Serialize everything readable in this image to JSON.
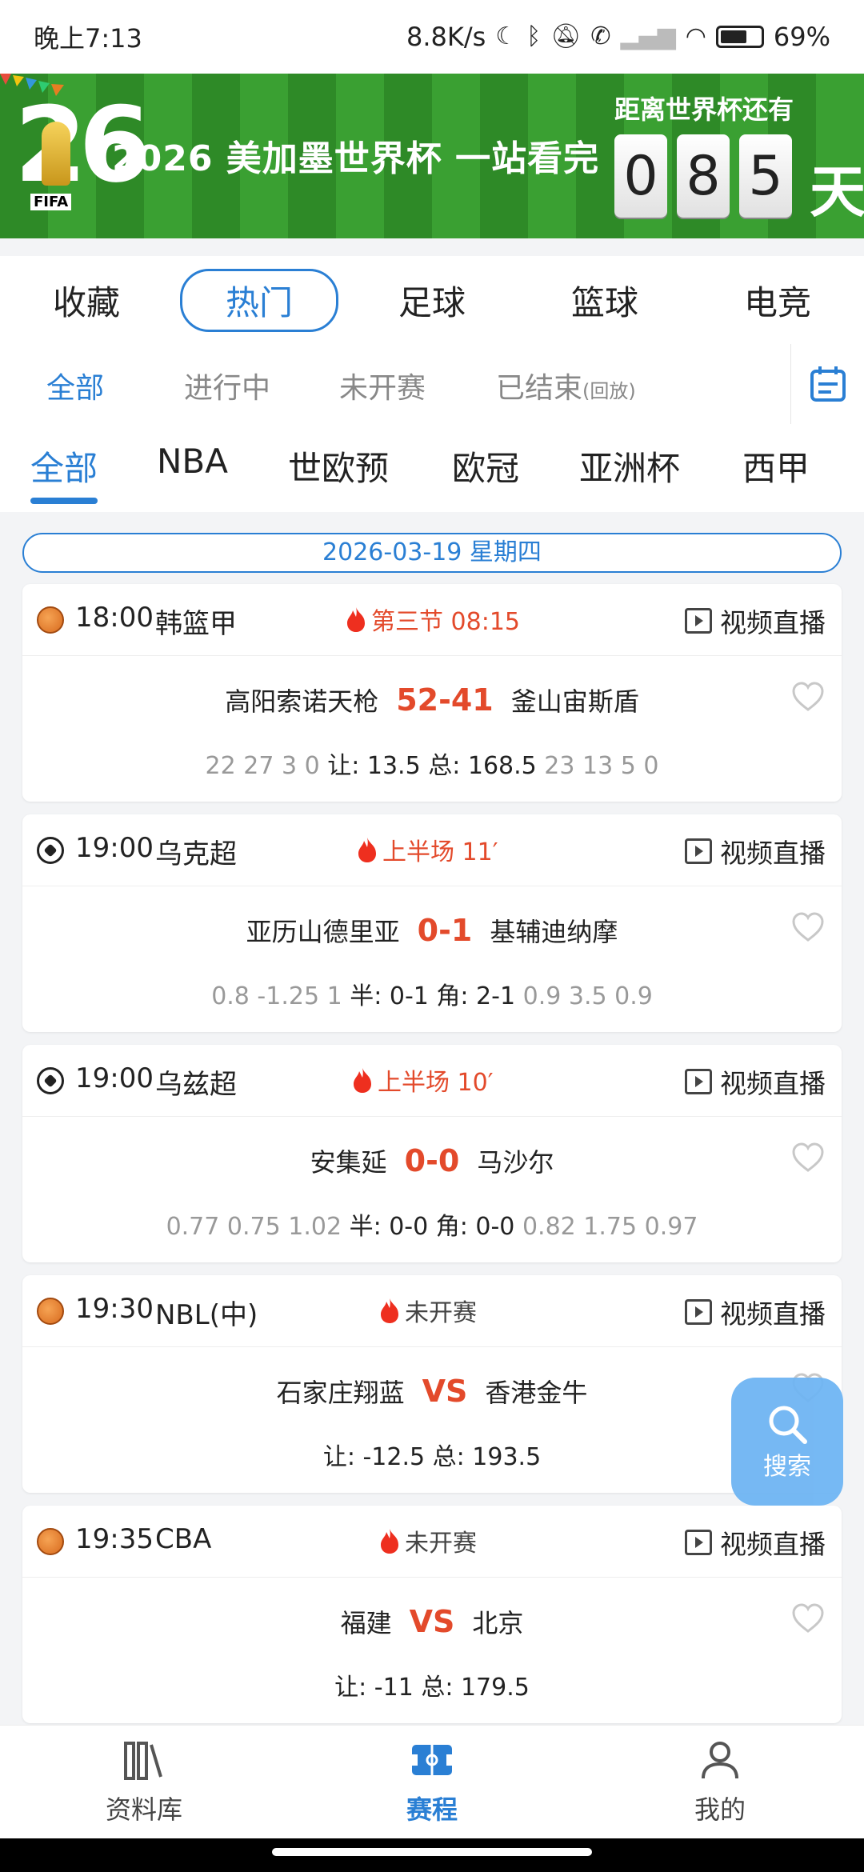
{
  "status_bar": {
    "time": "晚上7:13",
    "net_speed": "8.8K/s",
    "battery": "69%"
  },
  "banner": {
    "logo_year": "26",
    "logo_text": "FIFA",
    "title": "2026 美加墨世界杯 一站看完",
    "countdown_label": "距离世界杯还有",
    "digits": [
      "0",
      "8",
      "5"
    ],
    "unit": "天"
  },
  "top_tabs": [
    "收藏",
    "热门",
    "足球",
    "篮球",
    "电竞"
  ],
  "status_filters": {
    "all": "全部",
    "live": "进行中",
    "upcoming": "未开赛",
    "ended": "已结束",
    "ended_note": "(回放)"
  },
  "league_tabs": [
    "全部",
    "NBA",
    "世欧预",
    "欧冠",
    "亚洲杯",
    "西甲"
  ],
  "date_label": "2026-03-19 星期四",
  "video_label": "视频直播",
  "matches": [
    {
      "time": "18:00",
      "league": "韩篮甲",
      "status": "第三节 08:15",
      "home": "高阳索诺天枪",
      "score": "52-41",
      "away": "釜山宙斯盾",
      "odds_left": "22 27 3 0",
      "odds_mid": "让: 13.5  总: 168.5",
      "odds_right": "23 13 5 0"
    },
    {
      "time": "19:00",
      "league": "乌克超",
      "status": "上半场 11′",
      "home": "亚历山德里亚",
      "score": "0-1",
      "away": "基辅迪纳摩",
      "odds_left": "0.8 -1.25 1",
      "odds_mid": "半: 0-1  角: 2-1",
      "odds_right": "0.9 3.5 0.9"
    },
    {
      "time": "19:00",
      "league": "乌兹超",
      "status": "上半场 10′",
      "home": "安集延",
      "score": "0-0",
      "away": "马沙尔",
      "odds_left": "0.77 0.75 1.02",
      "odds_mid": "半: 0-0  角: 0-0",
      "odds_right": "0.82 1.75 0.97"
    },
    {
      "time": "19:30",
      "league": "NBL(中)",
      "status": "未开赛",
      "home": "石家庄翔蓝",
      "score": "VS",
      "away": "香港金牛",
      "odds_left": "",
      "odds_mid": "让: -12.5  总: 193.5",
      "odds_right": ""
    },
    {
      "time": "19:35",
      "league": "CBA",
      "status": "未开赛",
      "home": "福建",
      "score": "VS",
      "away": "北京",
      "odds_left": "",
      "odds_mid": "让: -11  总: 179.5",
      "odds_right": ""
    }
  ],
  "search_label": "搜索",
  "bottom_nav": [
    "资料库",
    "赛程",
    "我的"
  ],
  "colors": {
    "accent": "#2a7fd4",
    "live": "#e34a2b"
  }
}
